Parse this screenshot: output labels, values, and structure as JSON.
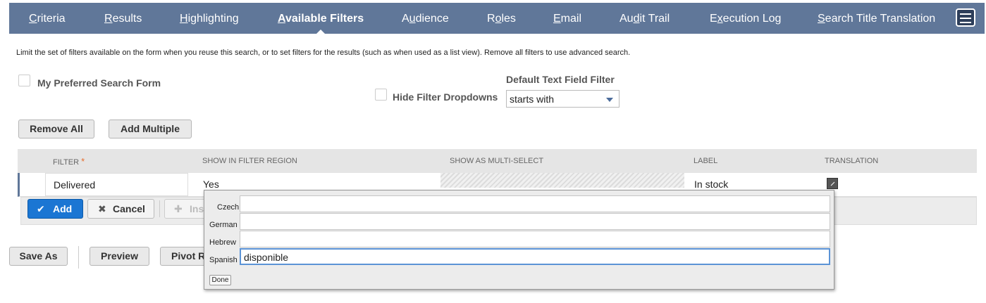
{
  "tabs": [
    {
      "pre": "",
      "key": "C",
      "post": "riteria"
    },
    {
      "pre": "",
      "key": "R",
      "post": "esults"
    },
    {
      "pre": "",
      "key": "H",
      "post": "ighlighting"
    },
    {
      "pre": "",
      "key": "A",
      "post": "vailable Filters"
    },
    {
      "pre": "A",
      "key": "u",
      "post": "dience"
    },
    {
      "pre": "R",
      "key": "o",
      "post": "les"
    },
    {
      "pre": "",
      "key": "E",
      "post": "mail"
    },
    {
      "pre": "Au",
      "key": "d",
      "post": "it Trail"
    },
    {
      "pre": "E",
      "key": "x",
      "post": "ecution Log"
    },
    {
      "pre": "",
      "key": "S",
      "post": "earch Title Translation"
    }
  ],
  "description": "Limit the set of filters available on the form when you reuse this search, or to set filters for the results (such as when used as a list view). Remove all filters to use advanced search.",
  "form": {
    "preferred_label": "My Preferred Search Form",
    "hide_dropdowns_label": "Hide Filter Dropdowns",
    "default_filter_label": "Default Text Field Filter",
    "default_filter_value": "starts with"
  },
  "buttons": {
    "remove_all": "Remove All",
    "add_multiple": "Add Multiple",
    "add": "Add",
    "cancel": "Cancel",
    "insert": "Ins",
    "save_as": "Save As",
    "preview": "Preview",
    "pivot": "Pivot R",
    "done": "Done"
  },
  "grid": {
    "headers": {
      "filter": "FILTER",
      "required": "*",
      "show_region": "SHOW IN FILTER REGION",
      "multi": "SHOW AS MULTI-SELECT",
      "label": "LABEL",
      "translation": "TRANSLATION"
    },
    "row": {
      "filter": "Delivered",
      "show_region": "Yes",
      "label": "In stock"
    }
  },
  "translations": [
    {
      "lang": "Czech",
      "value": ""
    },
    {
      "lang": "German",
      "value": ""
    },
    {
      "lang": "Hebrew",
      "value": ""
    },
    {
      "lang": "Spanish",
      "value": "disponible"
    }
  ],
  "colors": {
    "tabbar": "#607799",
    "primary_button": "#1b76d3",
    "required": "#e66c2c"
  }
}
